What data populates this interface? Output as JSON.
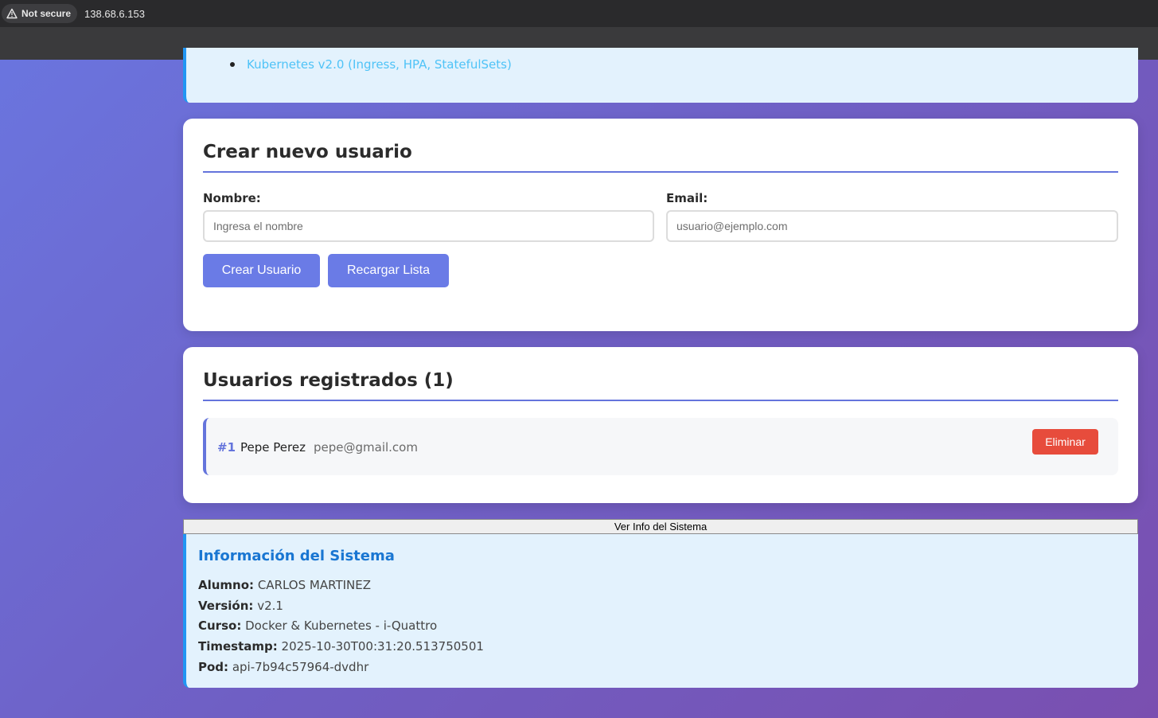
{
  "browser": {
    "security_label": "Not secure",
    "url": "138.68.6.153"
  },
  "tech_list": {
    "items": [
      "Kubernetes v2.0 (Ingress, HPA, StatefulSets)"
    ]
  },
  "create_user": {
    "title": "Crear nuevo usuario",
    "name_label": "Nombre:",
    "name_placeholder": "Ingresa el nombre",
    "name_value": "",
    "email_label": "Email:",
    "email_placeholder": "usuario@ejemplo.com",
    "email_value": "",
    "create_button": "Crear Usuario",
    "reload_button": "Recargar Lista"
  },
  "users": {
    "title": "Usuarios registrados (1)",
    "list": [
      {
        "id": "#1",
        "name": "Pepe Perez",
        "email": "pepe@gmail.com",
        "delete_label": "Eliminar"
      }
    ]
  },
  "system": {
    "toggle_button": "Ver Info del Sistema",
    "title": "Información del Sistema",
    "rows": [
      {
        "label": "Alumno:",
        "value": "CARLOS MARTINEZ"
      },
      {
        "label": "Versión:",
        "value": "v2.1"
      },
      {
        "label": "Curso:",
        "value": "Docker & Kubernetes - i-Quattro"
      },
      {
        "label": "Timestamp:",
        "value": "2025-10-30T00:31:20.513750501"
      },
      {
        "label": "Pod:",
        "value": "api-7b94c57964-dvdhr"
      }
    ]
  },
  "colors": {
    "accent": "#6474dc",
    "button": "#6a7be6",
    "danger": "#e74c3c",
    "info_bg": "#e3f2fd",
    "info_border": "#2196f3",
    "info_title": "#1976d2"
  },
  "icons": {
    "security": "warning-triangle-icon"
  }
}
